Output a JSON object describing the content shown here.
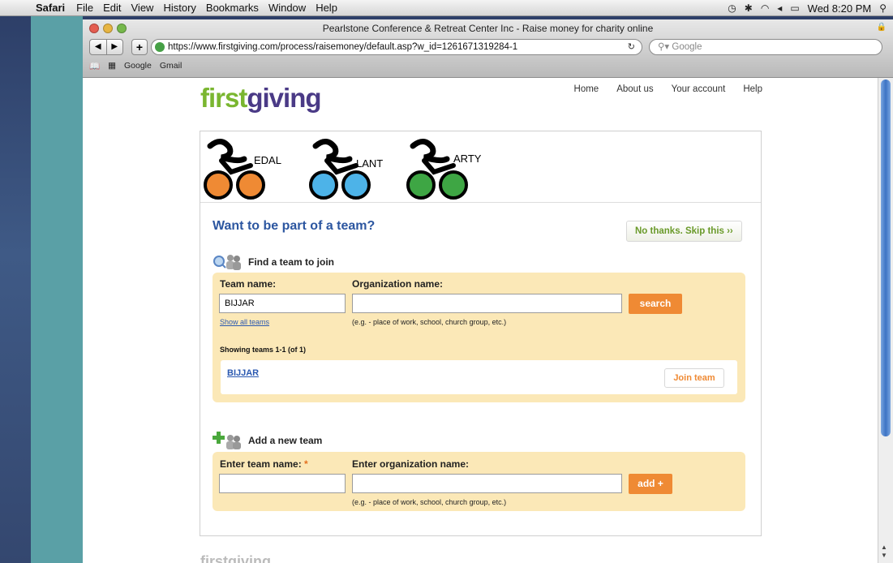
{
  "menubar": {
    "app": "Safari",
    "menus": [
      "File",
      "Edit",
      "View",
      "History",
      "Bookmarks",
      "Window",
      "Help"
    ],
    "clock": "Wed 8:20 PM"
  },
  "window": {
    "title": "Pearlstone Conference & Retreat Center Inc - Raise money for charity online",
    "url": "https://www.firstgiving.com/process/raisemoney/default.asp?w_id=1261671319284-1",
    "search_placeholder": "Google",
    "bookmarks": [
      "Google",
      "Gmail"
    ]
  },
  "site": {
    "logo_first": "first",
    "logo_giving": "giving",
    "nav": [
      "Home",
      "About us",
      "Your account",
      "Help"
    ],
    "banner_words": [
      "EDAL",
      "LANT",
      "ARTY"
    ]
  },
  "team": {
    "heading": "Want to be part of a team?",
    "skip_label": "No thanks. Skip this ››",
    "find": {
      "title": "Find a team to join",
      "team_label": "Team name:",
      "team_value": "BIJJAR",
      "org_label": "Organization name:",
      "org_value": "",
      "search_label": "search",
      "show_all": "Show all teams",
      "org_hint": "(e.g. - place of work, school, church group, etc.)",
      "showing": "Showing teams 1-1 (of 1)",
      "results": [
        {
          "name": "BIJJAR",
          "action": "Join team"
        }
      ]
    },
    "add": {
      "title": "Add a new team",
      "team_label": "Enter team name:",
      "required": "*",
      "org_label": "Enter organization name:",
      "add_label": "add +",
      "org_hint": "(e.g. - place of work, school, church group, etc.)"
    }
  },
  "colors": {
    "accent_orange": "#ef8a34",
    "panel_bg": "#fbe8b7",
    "heading_blue": "#2c56a0",
    "logo_green": "#7ab630",
    "logo_purple": "#4a3a86"
  }
}
